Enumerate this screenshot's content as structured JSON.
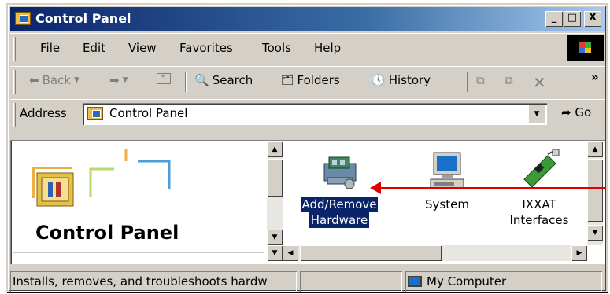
{
  "window": {
    "title": "Control Panel"
  },
  "title_buttons": {
    "minimize": "_",
    "maximize": "□",
    "close": "X"
  },
  "menu": {
    "items": [
      {
        "label": "File"
      },
      {
        "label": "Edit"
      },
      {
        "label": "View"
      },
      {
        "label": "Favorites"
      },
      {
        "label": "Tools"
      },
      {
        "label": "Help"
      }
    ]
  },
  "toolbar": {
    "back_label": "Back",
    "search_label": "Search",
    "folders_label": "Folders",
    "history_label": "History",
    "more": "»"
  },
  "address": {
    "label": "Address",
    "value": "Control Panel",
    "go_label": "Go"
  },
  "left_panel": {
    "title": "Control Panel"
  },
  "icons": [
    {
      "label_line1": "Add/Remove",
      "label_line2": "Hardware",
      "icon": "add-remove-hardware-icon",
      "selected": true
    },
    {
      "label_line1": "System",
      "label_line2": "",
      "icon": "system-monitor-icon",
      "selected": false
    },
    {
      "label_line1": "IXXAT",
      "label_line2": "Interfaces",
      "icon": "ixxat-card-icon",
      "selected": false
    }
  ],
  "status": {
    "description": "Installs, removes, and troubleshoots hardw",
    "zone": "My Computer"
  },
  "colors": {
    "title_bar_start": "#0a246a",
    "title_bar_end": "#a6caf0",
    "selection": "#0a246a",
    "annotation_arrow": "#e00000",
    "face": "#d4d0c8"
  }
}
